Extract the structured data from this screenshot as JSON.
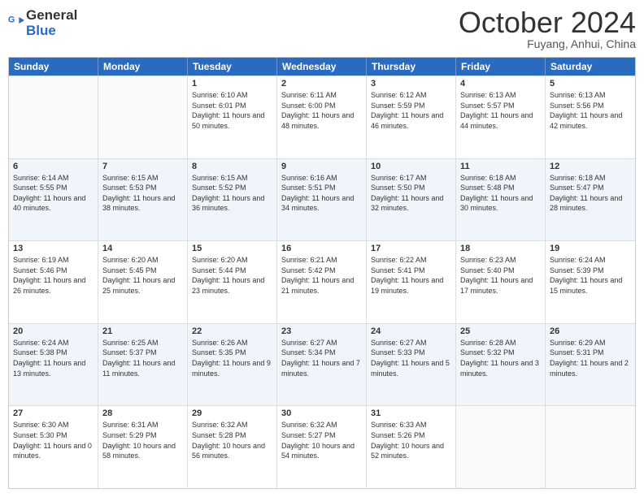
{
  "logo": {
    "line1": "General",
    "line2": "Blue"
  },
  "title": "October 2024",
  "subtitle": "Fuyang, Anhui, China",
  "dayHeaders": [
    "Sunday",
    "Monday",
    "Tuesday",
    "Wednesday",
    "Thursday",
    "Friday",
    "Saturday"
  ],
  "weeks": [
    {
      "alt": false,
      "days": [
        {
          "num": "",
          "info": ""
        },
        {
          "num": "",
          "info": ""
        },
        {
          "num": "1",
          "info": "Sunrise: 6:10 AM\nSunset: 6:01 PM\nDaylight: 11 hours and 50 minutes."
        },
        {
          "num": "2",
          "info": "Sunrise: 6:11 AM\nSunset: 6:00 PM\nDaylight: 11 hours and 48 minutes."
        },
        {
          "num": "3",
          "info": "Sunrise: 6:12 AM\nSunset: 5:59 PM\nDaylight: 11 hours and 46 minutes."
        },
        {
          "num": "4",
          "info": "Sunrise: 6:13 AM\nSunset: 5:57 PM\nDaylight: 11 hours and 44 minutes."
        },
        {
          "num": "5",
          "info": "Sunrise: 6:13 AM\nSunset: 5:56 PM\nDaylight: 11 hours and 42 minutes."
        }
      ]
    },
    {
      "alt": true,
      "days": [
        {
          "num": "6",
          "info": "Sunrise: 6:14 AM\nSunset: 5:55 PM\nDaylight: 11 hours and 40 minutes."
        },
        {
          "num": "7",
          "info": "Sunrise: 6:15 AM\nSunset: 5:53 PM\nDaylight: 11 hours and 38 minutes."
        },
        {
          "num": "8",
          "info": "Sunrise: 6:15 AM\nSunset: 5:52 PM\nDaylight: 11 hours and 36 minutes."
        },
        {
          "num": "9",
          "info": "Sunrise: 6:16 AM\nSunset: 5:51 PM\nDaylight: 11 hours and 34 minutes."
        },
        {
          "num": "10",
          "info": "Sunrise: 6:17 AM\nSunset: 5:50 PM\nDaylight: 11 hours and 32 minutes."
        },
        {
          "num": "11",
          "info": "Sunrise: 6:18 AM\nSunset: 5:48 PM\nDaylight: 11 hours and 30 minutes."
        },
        {
          "num": "12",
          "info": "Sunrise: 6:18 AM\nSunset: 5:47 PM\nDaylight: 11 hours and 28 minutes."
        }
      ]
    },
    {
      "alt": false,
      "days": [
        {
          "num": "13",
          "info": "Sunrise: 6:19 AM\nSunset: 5:46 PM\nDaylight: 11 hours and 26 minutes."
        },
        {
          "num": "14",
          "info": "Sunrise: 6:20 AM\nSunset: 5:45 PM\nDaylight: 11 hours and 25 minutes."
        },
        {
          "num": "15",
          "info": "Sunrise: 6:20 AM\nSunset: 5:44 PM\nDaylight: 11 hours and 23 minutes."
        },
        {
          "num": "16",
          "info": "Sunrise: 6:21 AM\nSunset: 5:42 PM\nDaylight: 11 hours and 21 minutes."
        },
        {
          "num": "17",
          "info": "Sunrise: 6:22 AM\nSunset: 5:41 PM\nDaylight: 11 hours and 19 minutes."
        },
        {
          "num": "18",
          "info": "Sunrise: 6:23 AM\nSunset: 5:40 PM\nDaylight: 11 hours and 17 minutes."
        },
        {
          "num": "19",
          "info": "Sunrise: 6:24 AM\nSunset: 5:39 PM\nDaylight: 11 hours and 15 minutes."
        }
      ]
    },
    {
      "alt": true,
      "days": [
        {
          "num": "20",
          "info": "Sunrise: 6:24 AM\nSunset: 5:38 PM\nDaylight: 11 hours and 13 minutes."
        },
        {
          "num": "21",
          "info": "Sunrise: 6:25 AM\nSunset: 5:37 PM\nDaylight: 11 hours and 11 minutes."
        },
        {
          "num": "22",
          "info": "Sunrise: 6:26 AM\nSunset: 5:35 PM\nDaylight: 11 hours and 9 minutes."
        },
        {
          "num": "23",
          "info": "Sunrise: 6:27 AM\nSunset: 5:34 PM\nDaylight: 11 hours and 7 minutes."
        },
        {
          "num": "24",
          "info": "Sunrise: 6:27 AM\nSunset: 5:33 PM\nDaylight: 11 hours and 5 minutes."
        },
        {
          "num": "25",
          "info": "Sunrise: 6:28 AM\nSunset: 5:32 PM\nDaylight: 11 hours and 3 minutes."
        },
        {
          "num": "26",
          "info": "Sunrise: 6:29 AM\nSunset: 5:31 PM\nDaylight: 11 hours and 2 minutes."
        }
      ]
    },
    {
      "alt": false,
      "days": [
        {
          "num": "27",
          "info": "Sunrise: 6:30 AM\nSunset: 5:30 PM\nDaylight: 11 hours and 0 minutes."
        },
        {
          "num": "28",
          "info": "Sunrise: 6:31 AM\nSunset: 5:29 PM\nDaylight: 10 hours and 58 minutes."
        },
        {
          "num": "29",
          "info": "Sunrise: 6:32 AM\nSunset: 5:28 PM\nDaylight: 10 hours and 56 minutes."
        },
        {
          "num": "30",
          "info": "Sunrise: 6:32 AM\nSunset: 5:27 PM\nDaylight: 10 hours and 54 minutes."
        },
        {
          "num": "31",
          "info": "Sunrise: 6:33 AM\nSunset: 5:26 PM\nDaylight: 10 hours and 52 minutes."
        },
        {
          "num": "",
          "info": ""
        },
        {
          "num": "",
          "info": ""
        }
      ]
    }
  ]
}
